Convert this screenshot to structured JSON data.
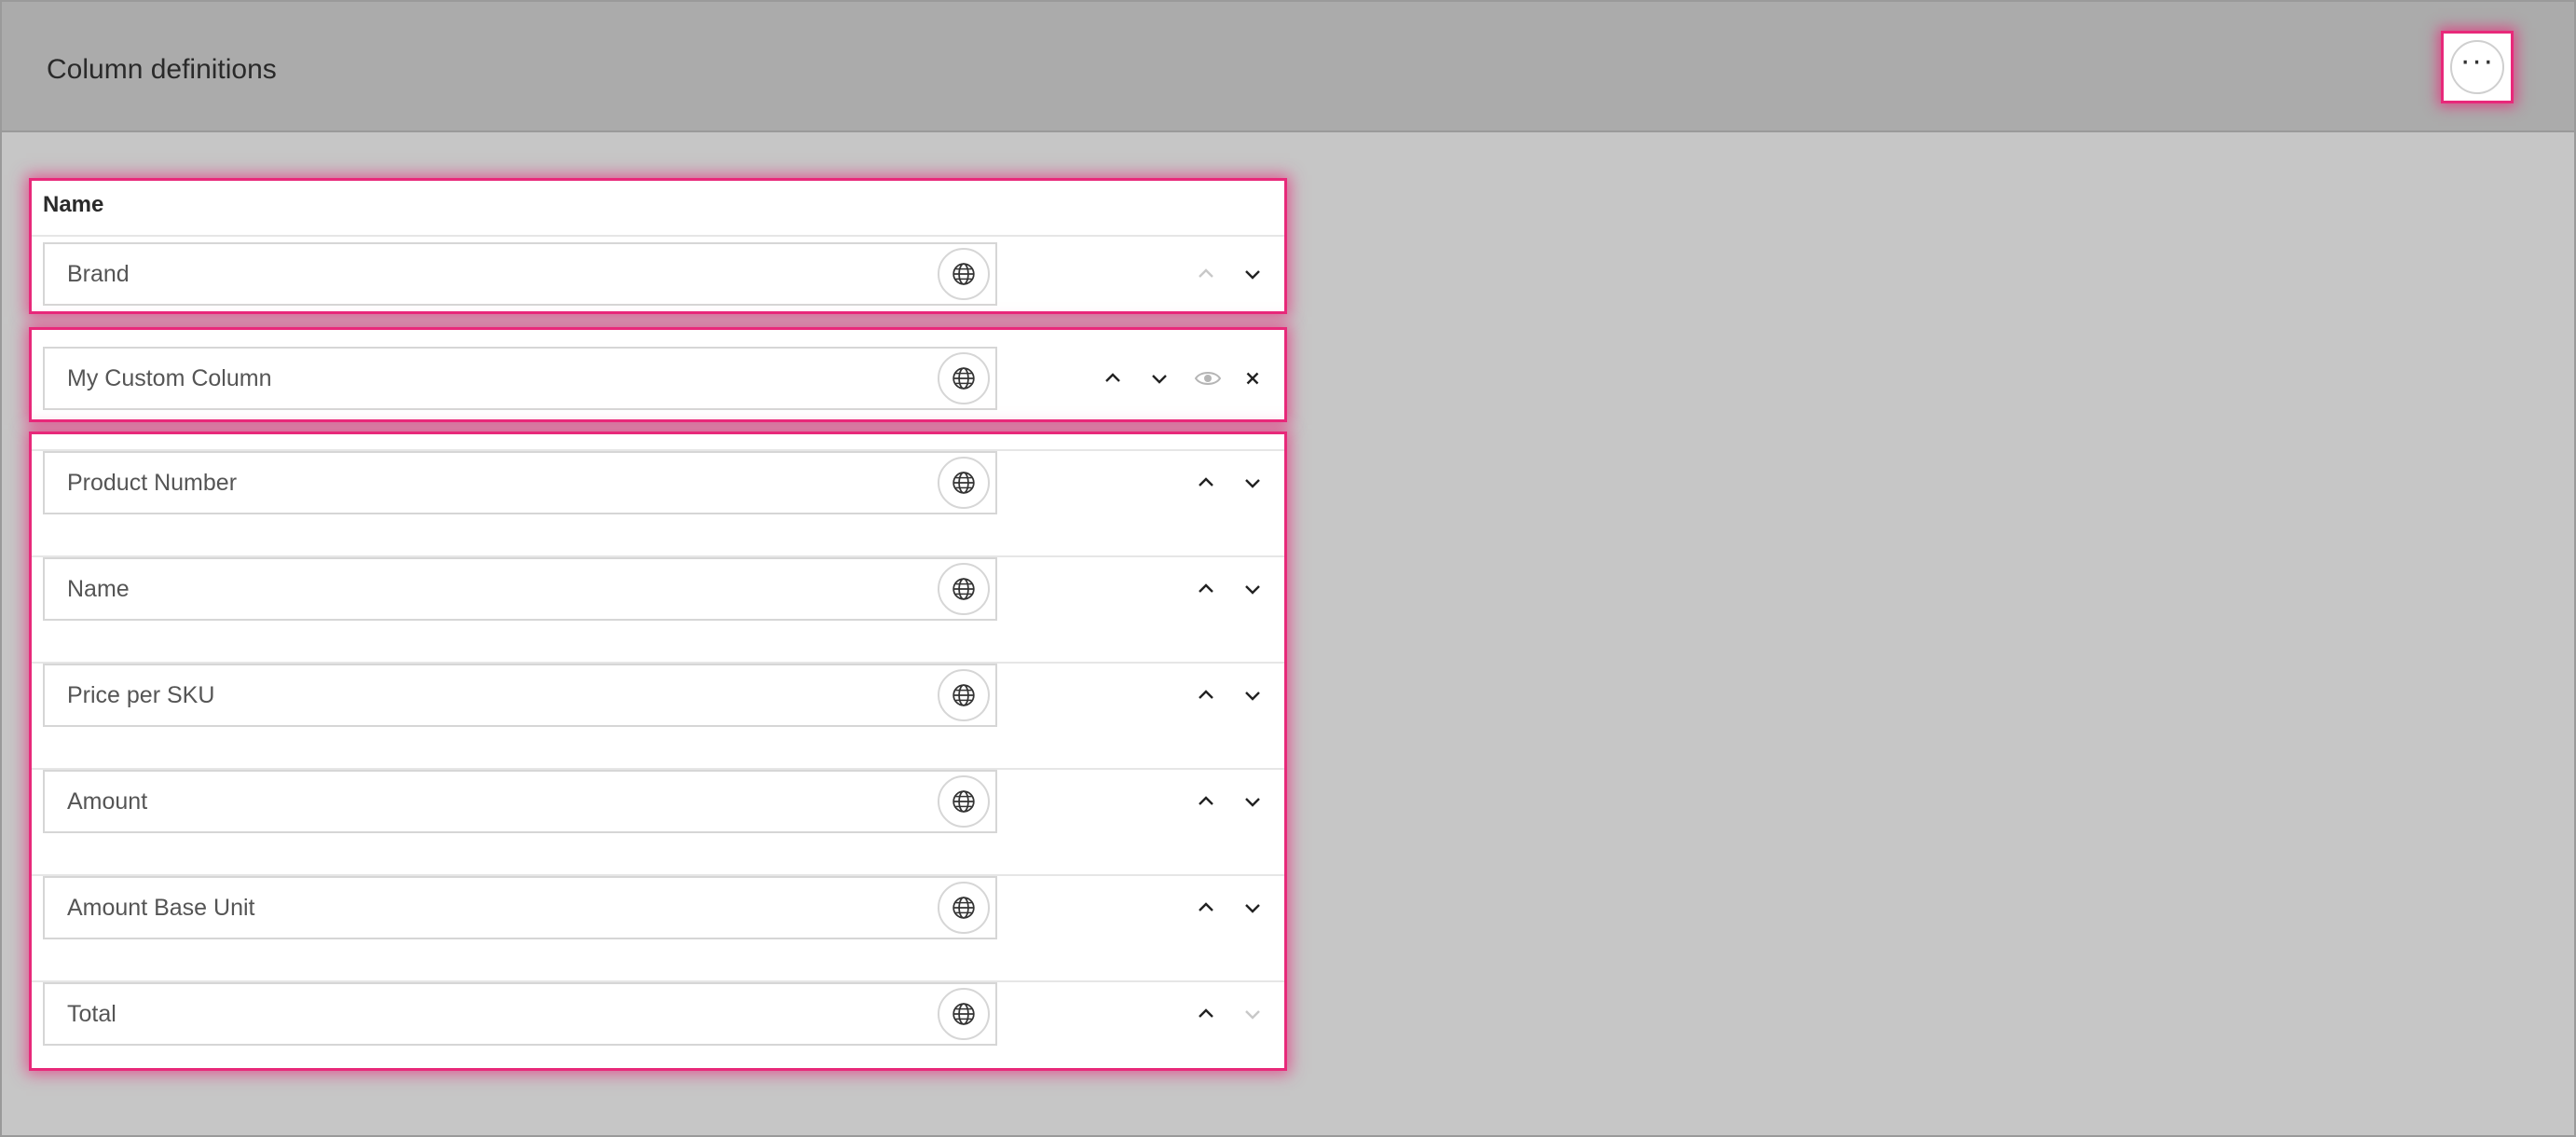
{
  "header": {
    "title": "Column definitions",
    "menu_icon": "more-horizontal-icon",
    "menu_label": "···"
  },
  "table": {
    "column_header": "Name"
  },
  "rows": [
    {
      "label": "Brand",
      "up_enabled": false,
      "down_enabled": true,
      "custom": false
    },
    {
      "label": "My Custom Column",
      "up_enabled": true,
      "down_enabled": true,
      "custom": true
    },
    {
      "label": "Product Number",
      "up_enabled": true,
      "down_enabled": true,
      "custom": false
    },
    {
      "label": "Name",
      "up_enabled": true,
      "down_enabled": true,
      "custom": false
    },
    {
      "label": "Price per SKU",
      "up_enabled": true,
      "down_enabled": true,
      "custom": false
    },
    {
      "label": "Amount",
      "up_enabled": true,
      "down_enabled": true,
      "custom": false
    },
    {
      "label": "Amount Base Unit",
      "up_enabled": true,
      "down_enabled": true,
      "custom": false
    },
    {
      "label": "Total",
      "up_enabled": true,
      "down_enabled": false,
      "custom": false
    }
  ],
  "colors": {
    "highlight": "#e8297a",
    "disabled": "#c8c8c8",
    "icon": "#222222"
  }
}
